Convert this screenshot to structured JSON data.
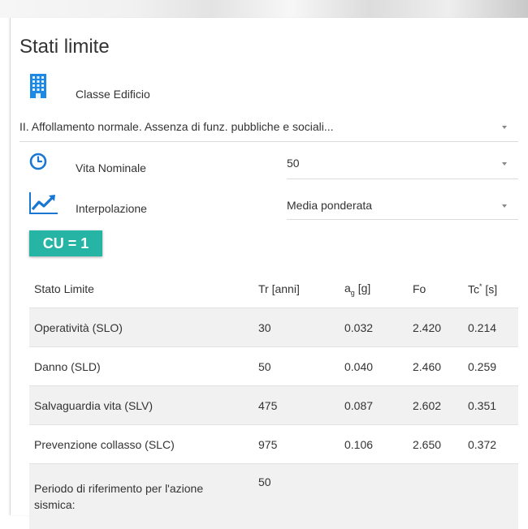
{
  "title": "Stati limite",
  "classe_edificio": {
    "label": "Classe Edificio",
    "value": "II. Affollamento normale. Assenza di funz. pubbliche e sociali..."
  },
  "vita_nominale": {
    "label": "Vita Nominale",
    "value": "50"
  },
  "interpolazione": {
    "label": "Interpolazione",
    "value": "Media ponderata"
  },
  "cu_badge": "CU = 1",
  "table": {
    "headers": {
      "stato_limite": "Stato Limite",
      "tr": "Tr [anni]",
      "ag_main": "a",
      "ag_sub": "g",
      "ag_unit": "[g]",
      "fo": "Fo",
      "tc_main": "Tc",
      "tc_sup": "*",
      "tc_unit": "[s]"
    },
    "rows": [
      {
        "stato": "Operatività (SLO)",
        "tr": "30",
        "ag": "0.032",
        "fo": "2.420",
        "tc": "0.214"
      },
      {
        "stato": "Danno (SLD)",
        "tr": "50",
        "ag": "0.040",
        "fo": "2.460",
        "tc": "0.259"
      },
      {
        "stato": "Salvaguardia vita (SLV)",
        "tr": "475",
        "ag": "0.087",
        "fo": "2.602",
        "tc": "0.351"
      },
      {
        "stato": "Prevenzione collasso (SLC)",
        "tr": "975",
        "ag": "0.106",
        "fo": "2.650",
        "tc": "0.372"
      }
    ],
    "periodo": {
      "label": "Periodo di riferimento per l'azione sismica:",
      "value": "50"
    }
  },
  "colors": {
    "accent_blue": "#1976d2",
    "badge_teal": "#26b5a5",
    "row_shade": "#f1f1f1"
  },
  "icons": {
    "building": "building-icon",
    "clock": "clock-icon",
    "chart": "trending-up-icon"
  }
}
